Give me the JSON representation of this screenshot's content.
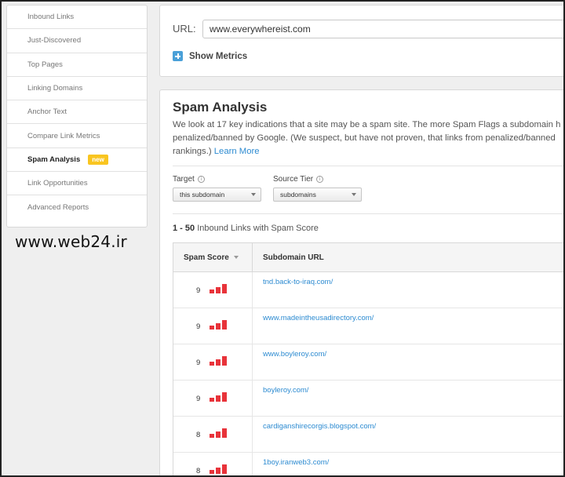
{
  "sidebar": {
    "items": [
      {
        "label": "Inbound Links",
        "active": false,
        "badge": ""
      },
      {
        "label": "Just-Discovered",
        "active": false,
        "badge": ""
      },
      {
        "label": "Top Pages",
        "active": false,
        "badge": ""
      },
      {
        "label": "Linking Domains",
        "active": false,
        "badge": ""
      },
      {
        "label": "Anchor Text",
        "active": false,
        "badge": ""
      },
      {
        "label": "Compare Link Metrics",
        "active": false,
        "badge": ""
      },
      {
        "label": "Spam Analysis",
        "active": true,
        "badge": "new"
      },
      {
        "label": "Link Opportunities",
        "active": false,
        "badge": ""
      },
      {
        "label": "Advanced Reports",
        "active": false,
        "badge": ""
      }
    ]
  },
  "watermark": "www.web24.ir",
  "url_panel": {
    "label": "URL:",
    "value": "www.everywhereist.com",
    "show_metrics": "Show Metrics"
  },
  "spam": {
    "title": "Spam Analysis",
    "desc_line1": "We look at 17 key indications that a site may be a spam site. The more Spam Flags a subdomain h",
    "desc_line2": "penalized/banned by Google. (We suspect, but have not proven, that links from penalized/banned",
    "desc_line3": "rankings.) ",
    "learn_more": "Learn More"
  },
  "filters": {
    "target_label": "Target",
    "target_value": "this subdomain",
    "tier_label": "Source Tier",
    "tier_value": "subdomains",
    "info_glyph": "i"
  },
  "results": {
    "range": "1 - 50",
    "text": " Inbound Links with Spam Score"
  },
  "table": {
    "col_score": "Spam Score",
    "col_url": "Subdomain URL",
    "rows": [
      {
        "score": "9",
        "url": "tnd.back-to-iraq.com/"
      },
      {
        "score": "9",
        "url": "www.madeintheusadirectory.com/"
      },
      {
        "score": "9",
        "url": "www.boyleroy.com/"
      },
      {
        "score": "9",
        "url": "boyleroy.com/"
      },
      {
        "score": "8",
        "url": "cardiganshirecorgis.blogspot.com/"
      },
      {
        "score": "8",
        "url": "1boy.iranweb3.com/"
      }
    ]
  },
  "colors": {
    "accent": "#2d8bd1",
    "spam_bar": "#e8333a",
    "badge": "#f9c520"
  }
}
